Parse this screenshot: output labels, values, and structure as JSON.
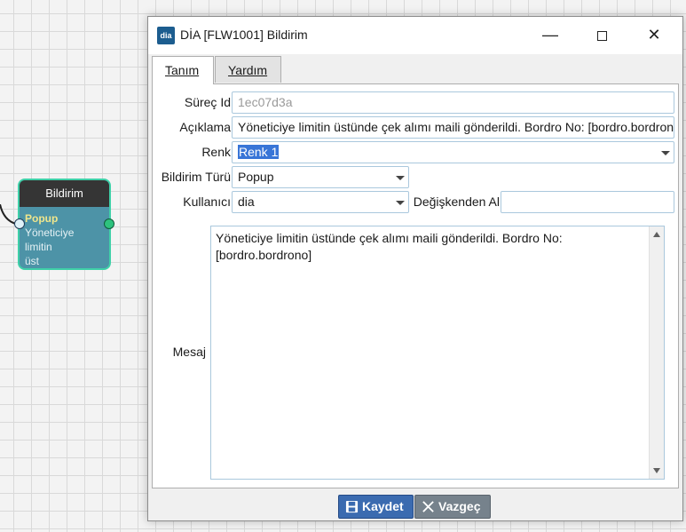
{
  "node": {
    "title": "Bildirim",
    "type": "Popup",
    "text_line1": "Yöneticiye limitin",
    "text_line2": "üst"
  },
  "window": {
    "logo": "dia",
    "title": "DİA [FLW1001] Bildirim",
    "minimize_icon": "minimize-icon",
    "maximize_icon": "maximize-icon",
    "close_icon": "close-icon",
    "close_glyph": "✕",
    "minimize_glyph": "—"
  },
  "tabs": [
    {
      "label": "Tanım",
      "active": true
    },
    {
      "label": "Yardım",
      "active": false
    }
  ],
  "form": {
    "surec_id": {
      "label": "Süreç Id",
      "value": "1ec07d3a"
    },
    "aciklama": {
      "label": "Açıklama",
      "value": "Yöneticiye limitin üstünde çek alımı maili gönderildi.  Bordro No: [bordro.bordrono]"
    },
    "renk": {
      "label": "Renk",
      "value": "Renk 1"
    },
    "bildirim_turu": {
      "label": "Bildirim Türü",
      "value": "Popup"
    },
    "kullanici": {
      "label": "Kullanıcı",
      "value": "dia"
    },
    "degiskenden_al": {
      "label": "Değişkenden Al",
      "value": ""
    },
    "mesaj": {
      "label": "Mesaj",
      "line1": "Yöneticiye limitin üstünde çek alımı maili gönderildi.  Bordro No:",
      "line2": "[bordro.bordrono]"
    }
  },
  "buttons": {
    "save": "Kaydet",
    "cancel": "Vazgeç"
  },
  "colors": {
    "save_button": "#3b6bb0",
    "cancel_button": "#76828c",
    "node_border": "#3fd0a8",
    "node_body": "#4d93a7"
  }
}
